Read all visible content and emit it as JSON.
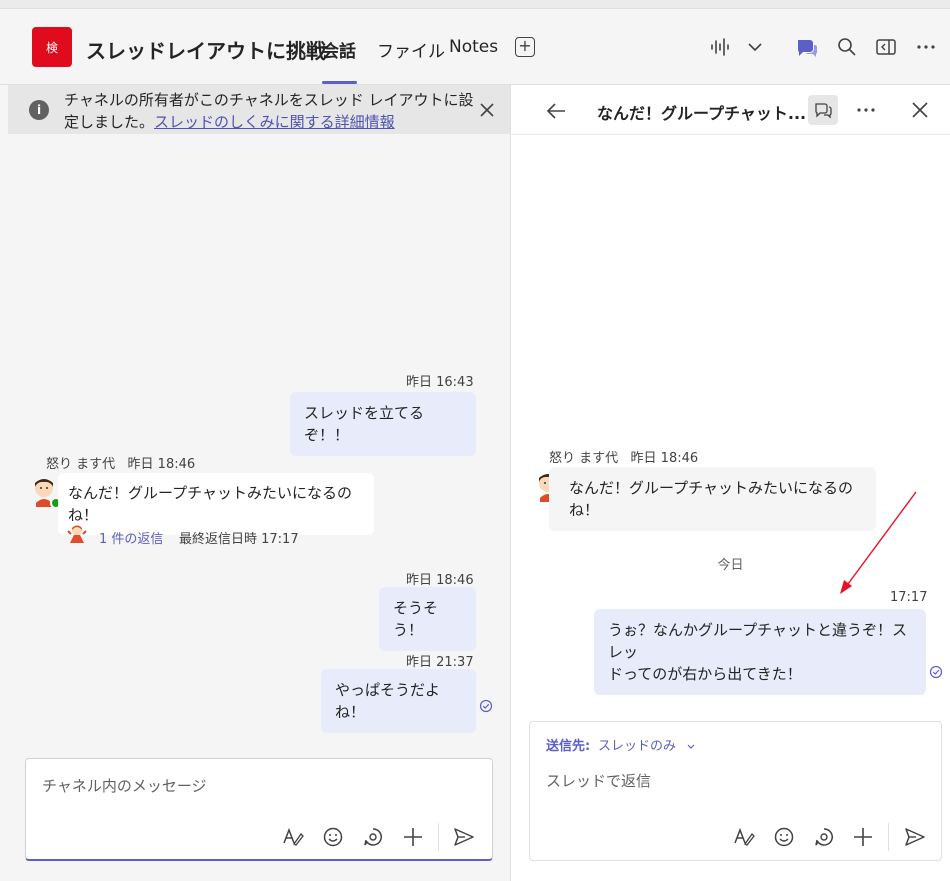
{
  "header": {
    "team_avatar_text": "検",
    "team_color": "#e00b1c",
    "channel_title": "スレッドレイアウトに挑戦",
    "tabs": [
      {
        "label": "会話",
        "active": true
      },
      {
        "label": "ファイル",
        "active": false
      },
      {
        "label": "Notes",
        "active": false
      }
    ],
    "add_tab_icon": "plus-box-icon",
    "right_icons": [
      "audio-wave-icon",
      "chevron-down-icon",
      "chat-icon",
      "search-icon",
      "open-panel-icon",
      "more-icon"
    ],
    "accent_color": "#5b5fc7"
  },
  "notice": {
    "text": "チャネルの所有者がこのチャネルをスレッド レイアウトに設定しました。",
    "link": "スレッドのしくみに関する詳細情報"
  },
  "left_messages": {
    "m1": {
      "time": "昨日 16:43",
      "text": "スレッドを立てるぞ！！"
    },
    "m2": {
      "sender": "怒り ます代",
      "time": "昨日 18:46",
      "text": "なんだ！グループチャットみたいになるのね！",
      "reply_count": "1 件の返信",
      "reply_last": "最終返信日時 17:17"
    },
    "m3": {
      "time": "昨日 18:46",
      "text": "そうそう！"
    },
    "m4": {
      "time": "昨日 21:37",
      "text": "やっぱそうだよね！"
    }
  },
  "left_composer": {
    "placeholder": "チャネル内のメッセージ"
  },
  "thread_panel": {
    "title": "なんだ！グループチャット...",
    "origin": {
      "sender": "怒り ます代",
      "time": "昨日 18:46",
      "text_line1": "なんだ！グループチャットみたいになるの",
      "text_line2": "ね！"
    },
    "divider": "今日",
    "reply": {
      "time": "17:17",
      "text_line1": "うぉ？なんかグループチャットと違うぞ！スレッ",
      "text_line2": "ドってのが右から出てきた！"
    },
    "composer": {
      "to_label": "送信先:",
      "to_value": "スレッドのみ",
      "placeholder": "スレッドで返信"
    }
  }
}
